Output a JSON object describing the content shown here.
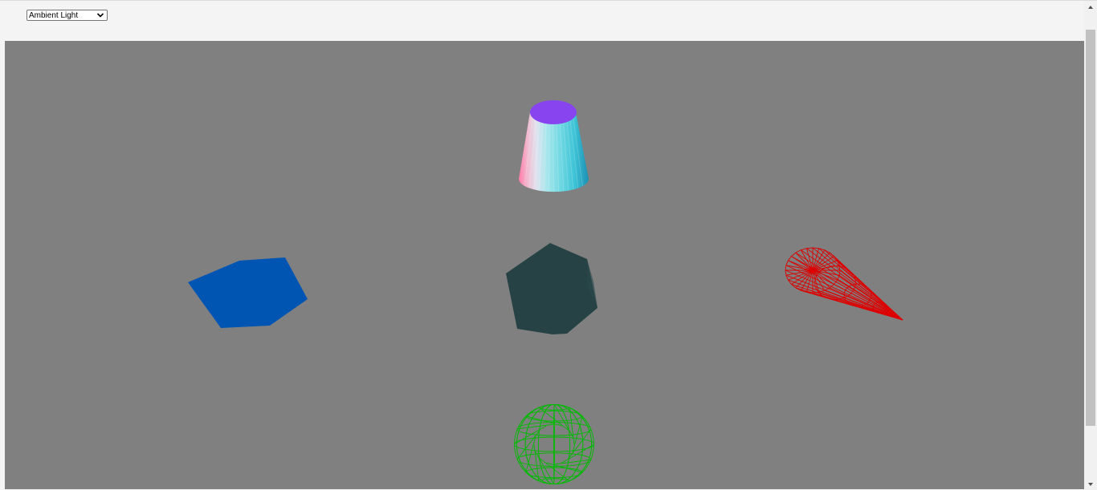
{
  "light_select": {
    "value": "Ambient Light"
  },
  "scene": {
    "background": "#808080",
    "objects": [
      {
        "name": "cylinder",
        "top_color": "#8844ee",
        "style": "shaded"
      },
      {
        "name": "blue-hexagon",
        "color": "#0055b3",
        "style": "solid"
      },
      {
        "name": "dark-polyhedron",
        "color": "#264244",
        "style": "solid"
      },
      {
        "name": "red-cone",
        "color": "#dd0000",
        "style": "wireframe"
      },
      {
        "name": "green-sphere",
        "color": "#00bb00",
        "style": "wireframe"
      }
    ]
  },
  "icons": {
    "dropdown": "chevron-down-icon",
    "scroll_up": "scroll-up-arrow-icon",
    "scroll_down": "scroll-down-arrow-icon"
  }
}
